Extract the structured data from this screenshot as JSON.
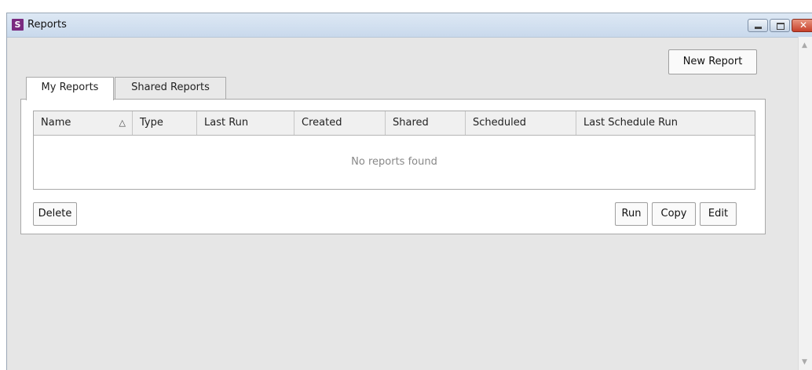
{
  "window": {
    "title": "Reports",
    "app_icon_letter": "S"
  },
  "toolbar": {
    "new_report_label": "New Report"
  },
  "tabs": [
    {
      "label": "My Reports",
      "active": true
    },
    {
      "label": "Shared Reports",
      "active": false
    }
  ],
  "table": {
    "columns": [
      "Name",
      "Type",
      "Last Run",
      "Created",
      "Shared",
      "Scheduled",
      "Last Schedule Run"
    ],
    "sort_indicator": "△",
    "empty_message": "No reports found",
    "rows": []
  },
  "actions": {
    "delete_label": "Delete",
    "run_label": "Run",
    "copy_label": "Copy",
    "edit_label": "Edit"
  },
  "colors": {
    "title_bar": "#c9d9ec",
    "close_button": "#c7402a",
    "app_icon": "#7a2a7f"
  }
}
